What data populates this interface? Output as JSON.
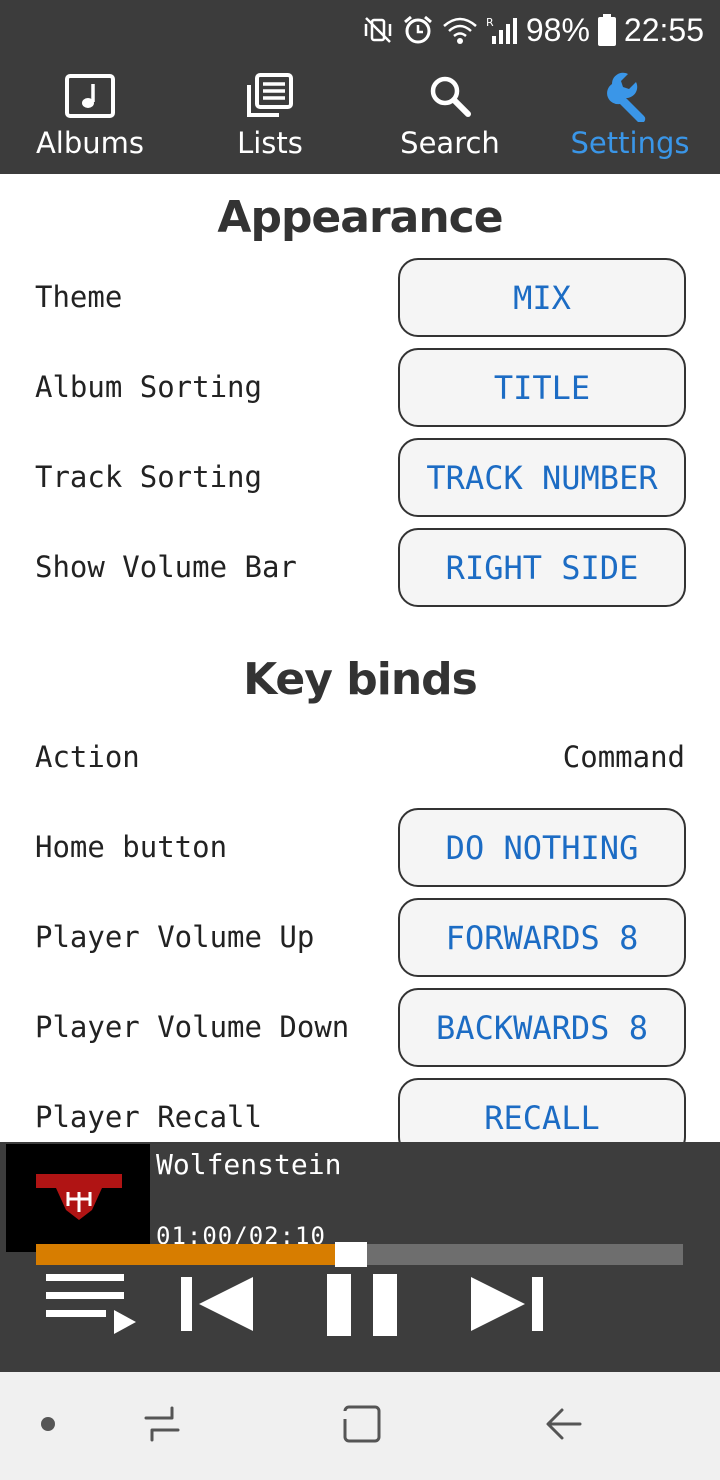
{
  "status_bar": {
    "battery": "98%",
    "time": "22:55",
    "icons": [
      "vibrate-mute-icon",
      "alarm-icon",
      "wifi-icon",
      "signal-icon",
      "battery-icon"
    ]
  },
  "nav": {
    "tabs": [
      {
        "label": "Albums",
        "icon": "music-note-icon",
        "active": false
      },
      {
        "label": "Lists",
        "icon": "list-icon",
        "active": false
      },
      {
        "label": "Search",
        "icon": "search-icon",
        "active": false
      },
      {
        "label": "Settings",
        "icon": "wrench-icon",
        "active": true
      }
    ],
    "active_color": "#3a96e8"
  },
  "appearance": {
    "title": "Appearance",
    "rows": [
      {
        "label": "Theme",
        "value": "MIX"
      },
      {
        "label": "Album Sorting",
        "value": "TITLE"
      },
      {
        "label": "Track Sorting",
        "value": "TRACK NUMBER"
      },
      {
        "label": "Show Volume Bar",
        "value": "RIGHT SIDE"
      }
    ]
  },
  "key_binds": {
    "title": "Key binds",
    "header": {
      "action": "Action",
      "command": "Command"
    },
    "rows": [
      {
        "label": "Home button",
        "value": "DO NOTHING"
      },
      {
        "label": "Player Volume Up",
        "value": "FORWARDS 8"
      },
      {
        "label": "Player Volume Down",
        "value": "BACKWARDS 8"
      },
      {
        "label": "Player Recall",
        "value": "RECALL"
      }
    ]
  },
  "player": {
    "track_title": "Wolfenstein",
    "time": "01:00/02:10",
    "album_art_text": "Wolfenstein",
    "progress_fraction": 0.4615,
    "progress_color": "#d77d00",
    "state": "playing"
  },
  "colors": {
    "bar_background": "#3c3c3c",
    "button_text": "#1c6cc4"
  }
}
